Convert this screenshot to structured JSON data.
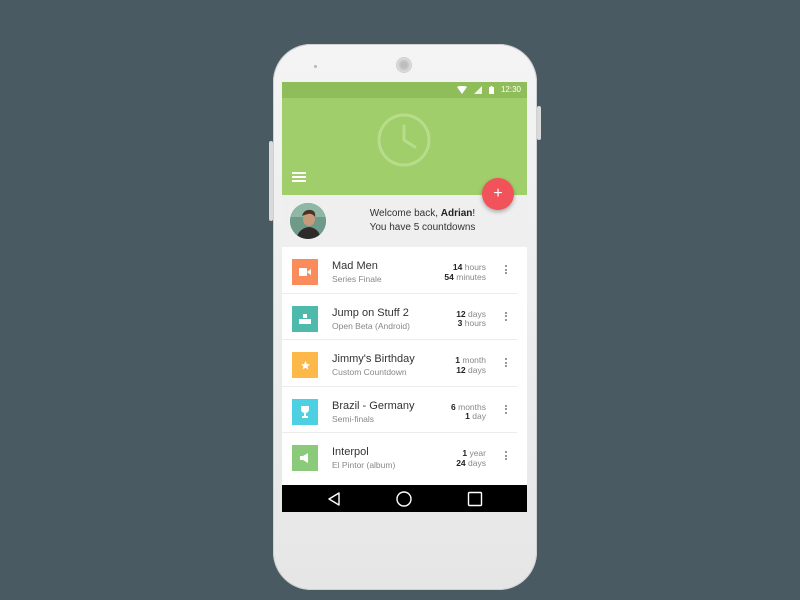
{
  "status_bar": {
    "time": "12:30"
  },
  "header": {
    "accent": "#a0ce6a",
    "status_color": "#8fbd5a"
  },
  "welcome": {
    "greeting": "Welcome back, ",
    "user_name": "Adrian",
    "exclaim": "!",
    "summary": "You have 5 countdowns"
  },
  "fab": {
    "label": "+",
    "color": "#f2525a"
  },
  "countdowns": [
    {
      "title": "Mad Men",
      "subtitle": "Series Finale",
      "icon": "video-icon",
      "color": "#f98c5a",
      "t1_value": "14",
      "t1_unit": "hours",
      "t2_value": "54",
      "t2_unit": "minutes"
    },
    {
      "title": "Jump on Stuff 2",
      "subtitle": "Open Beta (Android)",
      "icon": "game-icon",
      "color": "#4fb9ab",
      "t1_value": "12",
      "t1_unit": "days",
      "t2_value": "3",
      "t2_unit": "hours"
    },
    {
      "title": "Jimmy's Birthday",
      "subtitle": "Custom Countdown",
      "icon": "star-icon",
      "color": "#fdb84a",
      "t1_value": "1",
      "t1_unit": "month",
      "t2_value": "12",
      "t2_unit": "days"
    },
    {
      "title": "Brazil - Germany",
      "subtitle": "Semi-finals",
      "icon": "trophy-icon",
      "color": "#4dd0e1",
      "t1_value": "6",
      "t1_unit": "months",
      "t2_value": "1",
      "t2_unit": "day"
    },
    {
      "title": "Interpol",
      "subtitle": "El Pintor (album)",
      "icon": "speaker-icon",
      "color": "#8bc97b",
      "t1_value": "1",
      "t1_unit": "year",
      "t2_value": "24",
      "t2_unit": "days"
    }
  ]
}
